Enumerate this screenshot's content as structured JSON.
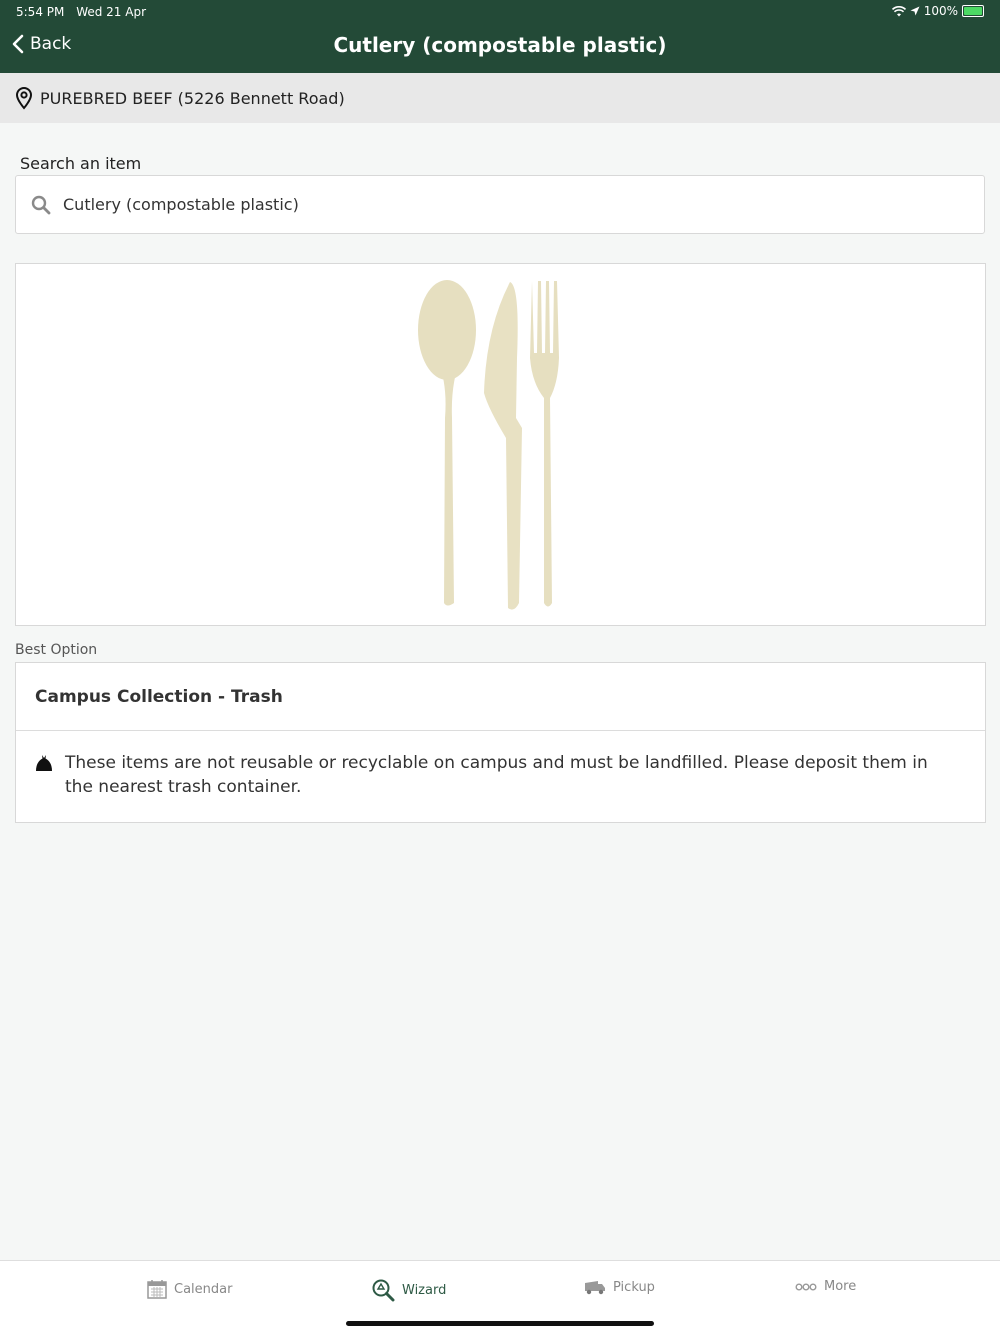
{
  "status_bar": {
    "time": "5:54 PM",
    "date": "Wed 21 Apr",
    "battery": "100%"
  },
  "nav": {
    "back_label": "Back",
    "title": "Cutlery (compostable plastic)"
  },
  "location": {
    "text": "PUREBRED BEEF (5226 Bennett Road)"
  },
  "search": {
    "label": "Search an item",
    "value": "Cutlery (compostable plastic)"
  },
  "best_option": {
    "section_label": "Best Option",
    "title": "Campus Collection - Trash",
    "description": "These items are not reusable or recyclable on campus and must be landfilled.  Please deposit them in the nearest trash container."
  },
  "tabs": [
    {
      "label": "Calendar",
      "icon": "calendar-icon",
      "active": false
    },
    {
      "label": "Wizard",
      "icon": "recycle-search-icon",
      "active": true
    },
    {
      "label": "Pickup",
      "icon": "truck-icon",
      "active": false
    },
    {
      "label": "More",
      "icon": "more-dots-icon",
      "active": false
    }
  ],
  "colors": {
    "header": "#234a37",
    "active_tab": "#2e5a45",
    "cutlery": "#e7e0c2"
  }
}
